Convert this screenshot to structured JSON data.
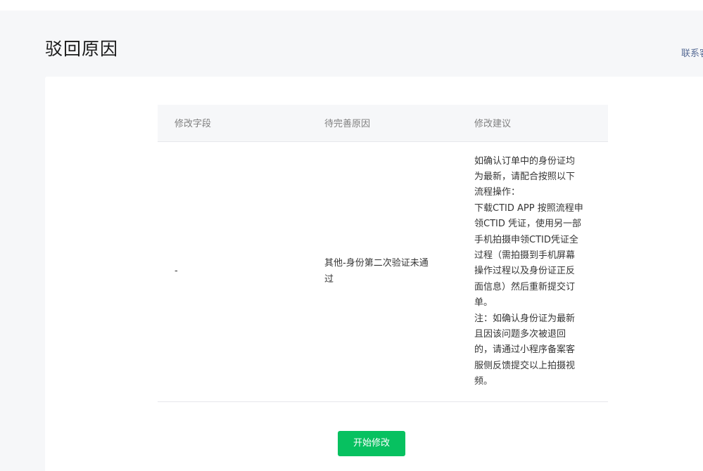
{
  "header": {
    "title": "驳回原因",
    "contact_link": "联系客服"
  },
  "table": {
    "columns": [
      "修改字段",
      "待完善原因",
      "修改建议"
    ],
    "rows": [
      {
        "field": "-",
        "reason_lines": [
          "其他-身份第二次验证未通",
          "过"
        ],
        "suggestion_lines": [
          "如确认订单中的身份证均",
          "为最新，请配合按照以下",
          "流程操作：",
          "下载CTID APP 按照流程申",
          "领CTID 凭证，使用另一部",
          "手机拍摄申领CTID凭证全",
          "过程（需拍摄到手机屏幕",
          "操作过程以及身份证正反",
          "面信息）然后重新提交订",
          "单。",
          "注：如确认身份证为最新",
          "且因该问题多次被退回",
          "的，请通过小程序备案客",
          "服侧反馈提交以上拍摄视",
          "频。"
        ]
      }
    ]
  },
  "actions": {
    "start_label": "开始修改"
  },
  "colors": {
    "primary_button": "#07c160",
    "link": "#576b95",
    "page_background": "#f6f7f9",
    "table_header_background": "#f6f7f9"
  }
}
